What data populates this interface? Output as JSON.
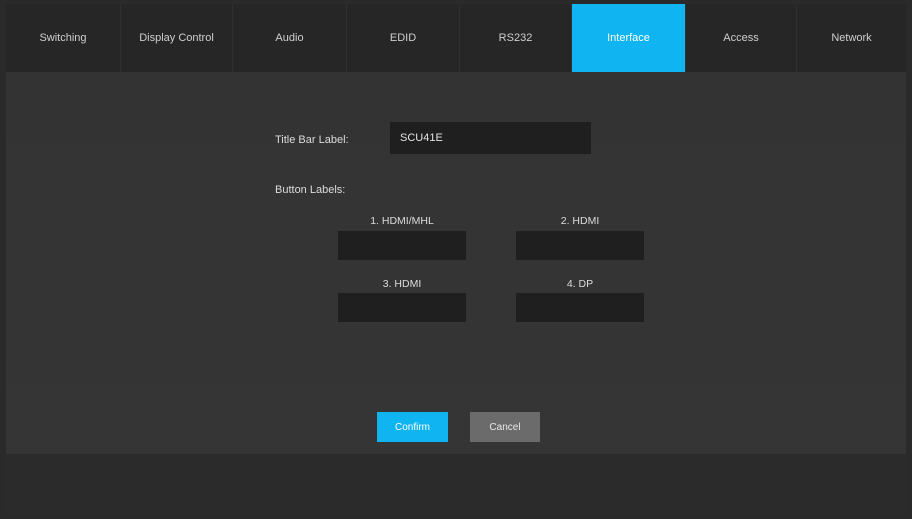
{
  "tabs": [
    {
      "label": "Switching",
      "active": false
    },
    {
      "label": "Display Control",
      "active": false
    },
    {
      "label": "Audio",
      "active": false
    },
    {
      "label": "EDID",
      "active": false
    },
    {
      "label": "RS232",
      "active": false
    },
    {
      "label": "Interface",
      "active": true
    },
    {
      "label": "Access",
      "active": false
    },
    {
      "label": "Network",
      "active": false
    }
  ],
  "interface": {
    "title_bar_label": "Title Bar Label:",
    "title_bar_value": "SCU41E",
    "button_labels_heading": "Button Labels:",
    "buttons": [
      {
        "caption": "1. HDMI/MHL",
        "value": ""
      },
      {
        "caption": "2. HDMI",
        "value": ""
      },
      {
        "caption": "3. HDMI",
        "value": ""
      },
      {
        "caption": "4. DP",
        "value": ""
      }
    ],
    "confirm_label": "Confirm",
    "cancel_label": "Cancel"
  },
  "colors": {
    "accent": "#0fb4f0",
    "background": "#333333",
    "tabbar": "#262626",
    "field": "#1f1f1f",
    "cancel": "#6b6b6b"
  }
}
